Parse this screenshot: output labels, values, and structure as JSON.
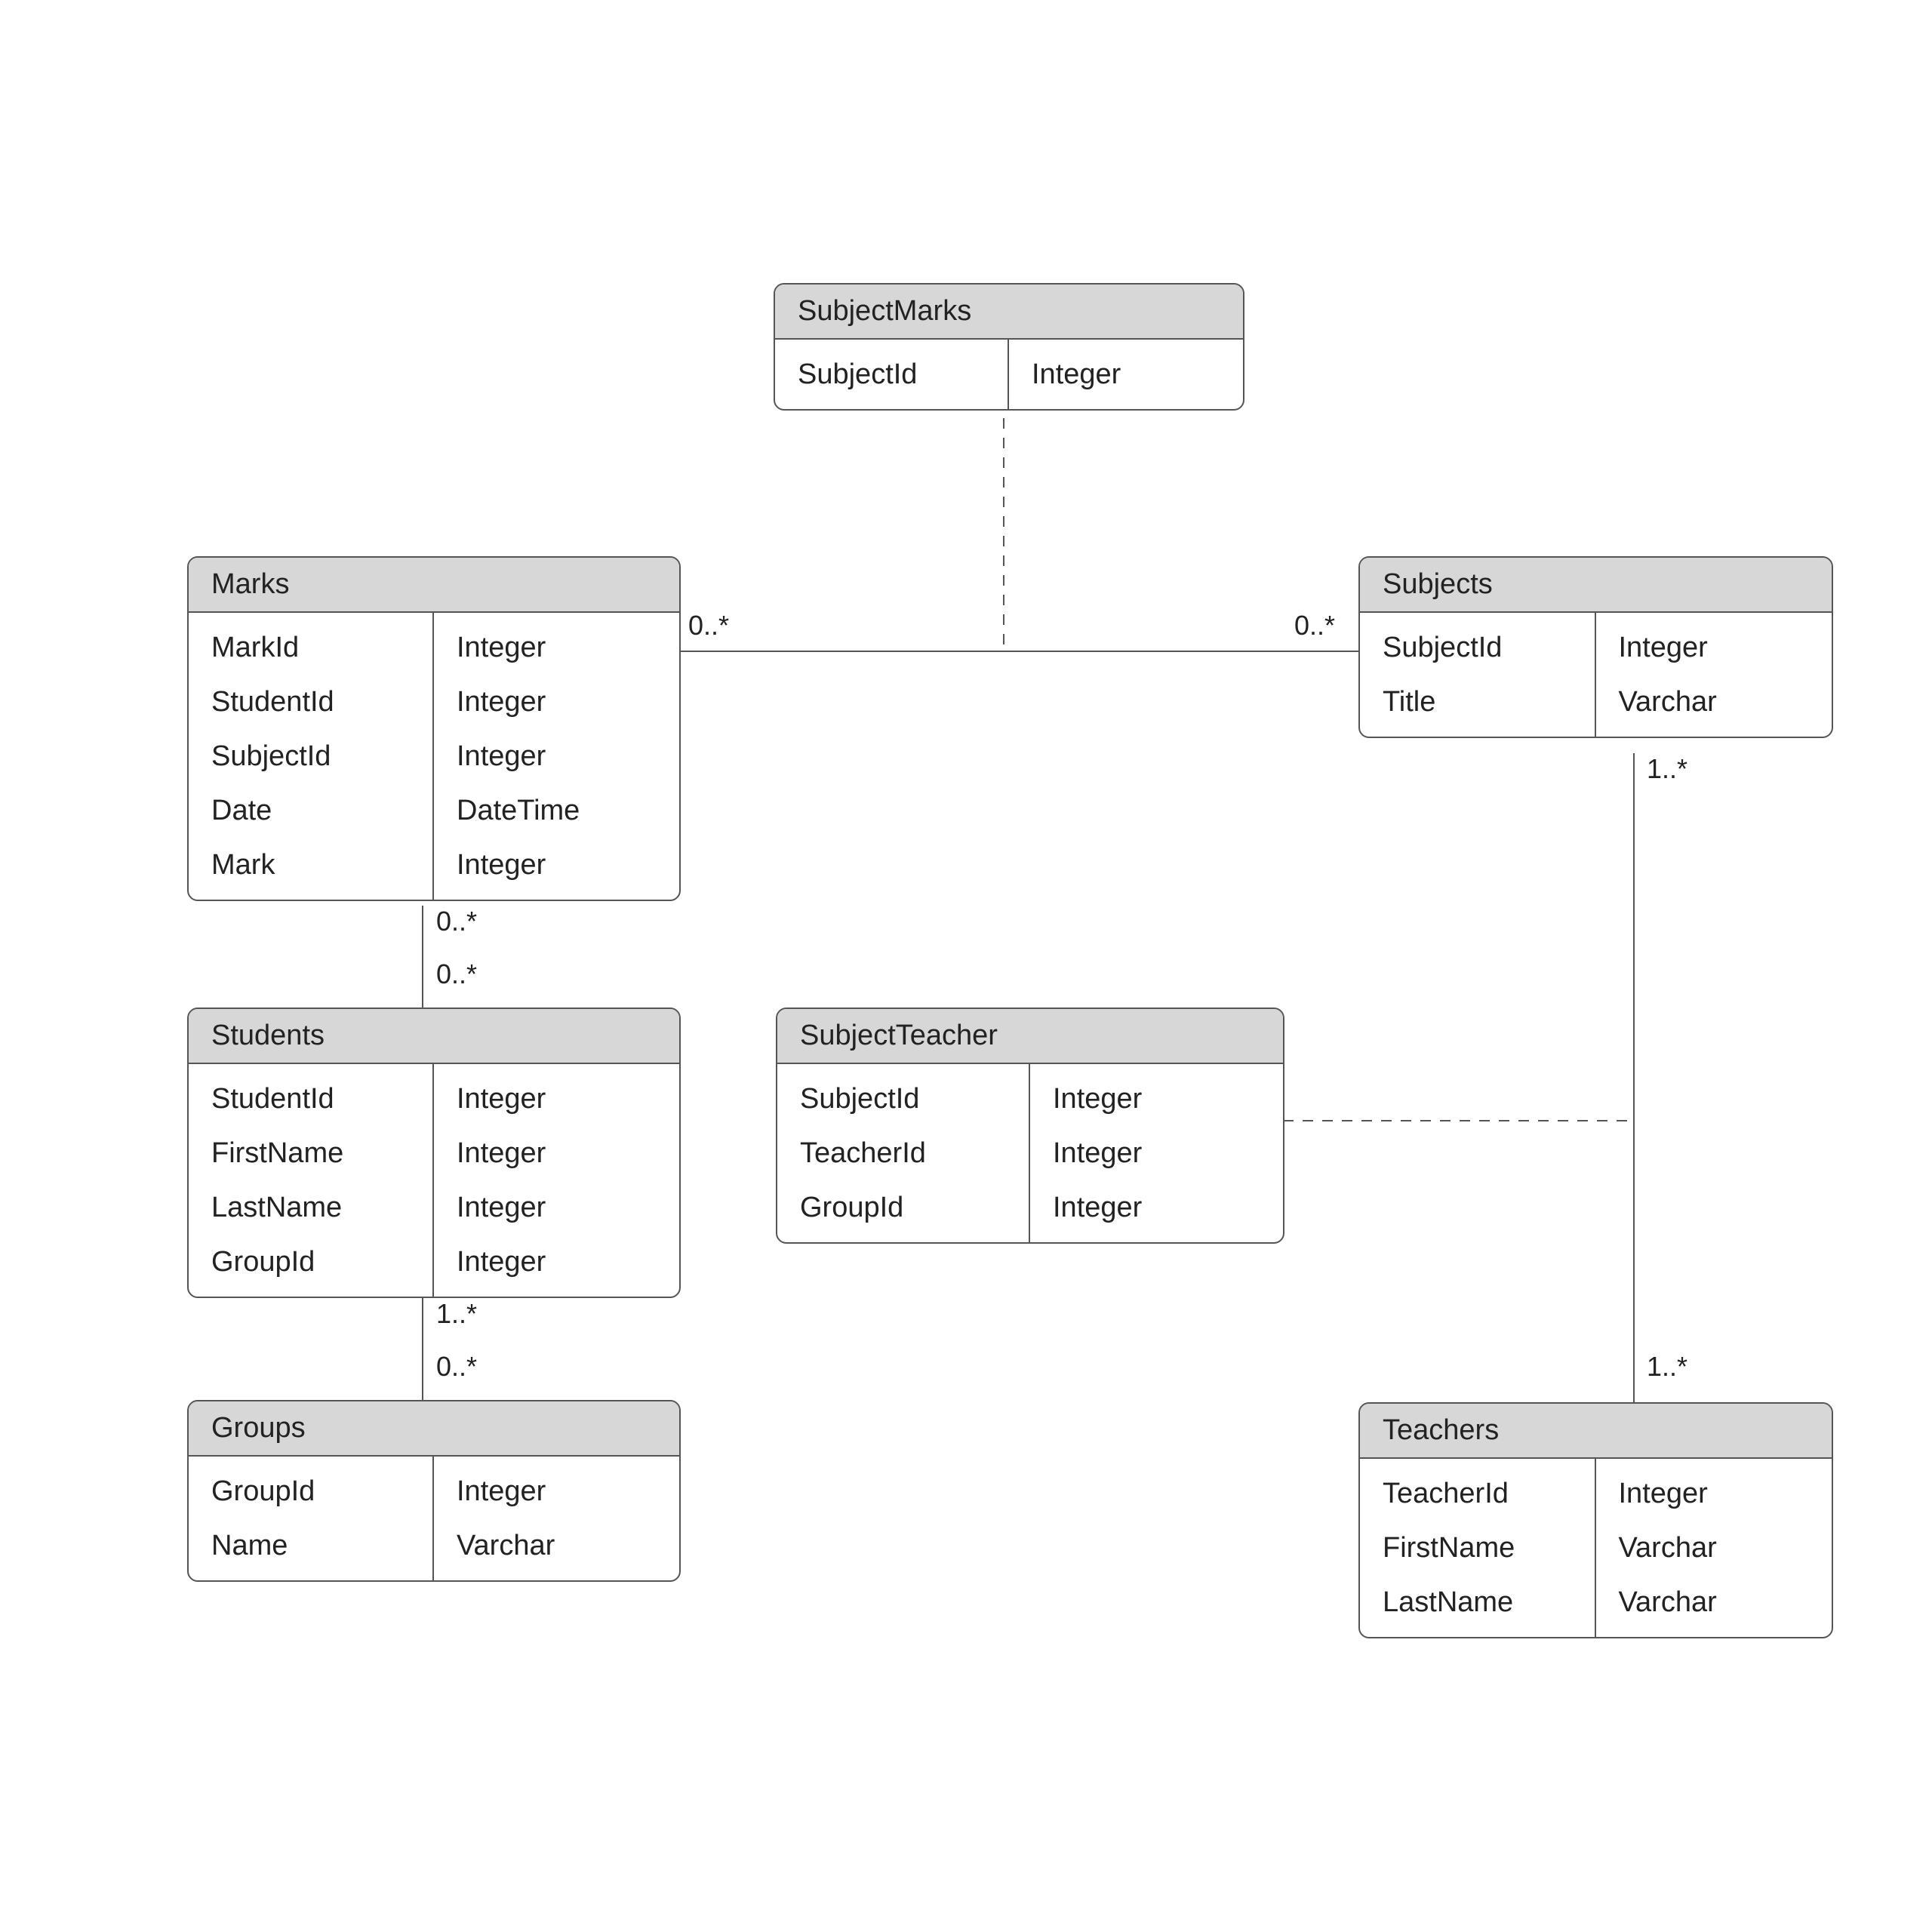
{
  "entities": {
    "subjectMarks": {
      "title": "SubjectMarks",
      "fields": [
        {
          "name": "SubjectId",
          "type": "Integer"
        }
      ]
    },
    "marks": {
      "title": "Marks",
      "fields": [
        {
          "name": "MarkId",
          "type": "Integer"
        },
        {
          "name": "StudentId",
          "type": "Integer"
        },
        {
          "name": "SubjectId",
          "type": "Integer"
        },
        {
          "name": "Date",
          "type": "DateTime"
        },
        {
          "name": "Mark",
          "type": "Integer"
        }
      ]
    },
    "subjects": {
      "title": "Subjects",
      "fields": [
        {
          "name": "SubjectId",
          "type": "Integer"
        },
        {
          "name": "Title",
          "type": "Varchar"
        }
      ]
    },
    "students": {
      "title": "Students",
      "fields": [
        {
          "name": "StudentId",
          "type": "Integer"
        },
        {
          "name": "FirstName",
          "type": "Integer"
        },
        {
          "name": "LastName",
          "type": "Integer"
        },
        {
          "name": "GroupId",
          "type": "Integer"
        }
      ]
    },
    "subjectTeacher": {
      "title": "SubjectTeacher",
      "fields": [
        {
          "name": "SubjectId",
          "type": "Integer"
        },
        {
          "name": "TeacherId",
          "type": "Integer"
        },
        {
          "name": "GroupId",
          "type": "Integer"
        }
      ]
    },
    "groups": {
      "title": "Groups",
      "fields": [
        {
          "name": "GroupId",
          "type": "Integer"
        },
        {
          "name": "Name",
          "type": "Varchar"
        }
      ]
    },
    "teachers": {
      "title": "Teachers",
      "fields": [
        {
          "name": "TeacherId",
          "type": "Integer"
        },
        {
          "name": "FirstName",
          "type": "Varchar"
        },
        {
          "name": "LastName",
          "type": "Varchar"
        }
      ]
    }
  },
  "multiplicities": {
    "marks_subjects_left": "0..*",
    "marks_subjects_right": "0..*",
    "marks_students_top": "0..*",
    "marks_students_bottom": "0..*",
    "students_groups_top": "1..*",
    "students_groups_bottom": "0..*",
    "subjects_teachers_top": "1..*",
    "subjects_teachers_bottom": "1..*"
  }
}
